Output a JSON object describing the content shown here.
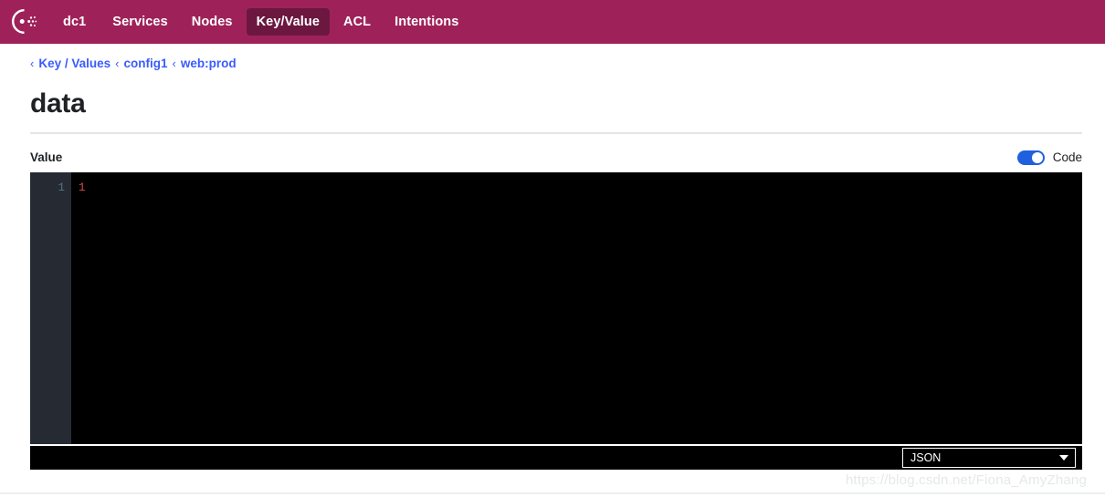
{
  "nav": {
    "logo_icon": "consul-logo-icon",
    "datacenter": "dc1",
    "items": [
      {
        "label": "Services",
        "active": false
      },
      {
        "label": "Nodes",
        "active": false
      },
      {
        "label": "Key/Value",
        "active": true
      },
      {
        "label": "ACL",
        "active": false
      },
      {
        "label": "Intentions",
        "active": false
      }
    ],
    "brand_color": "#9e2259",
    "active_tab_color": "#6b1740"
  },
  "breadcrumb": {
    "separator": "‹",
    "items": [
      {
        "label": "Key / Values"
      },
      {
        "label": "config1"
      },
      {
        "label": "web:prod"
      }
    ],
    "link_color": "#3b5bfd"
  },
  "page": {
    "title": "data"
  },
  "value_section": {
    "label": "Value",
    "toggle": {
      "label": "Code",
      "state": "on",
      "accent_color": "#2060df"
    }
  },
  "editor": {
    "lines": [
      {
        "number": "1",
        "text": "1",
        "token": "number"
      }
    ],
    "line_number": "1",
    "content": "1",
    "background_color": "#000000",
    "gutter_color": "#262b33",
    "number_token_color": "#e0484c",
    "language_select": {
      "value": "JSON",
      "caret_icon": "chevron-down-icon"
    }
  },
  "watermark": {
    "text": "https://blog.csdn.net/Fiona_AmyZhang"
  }
}
